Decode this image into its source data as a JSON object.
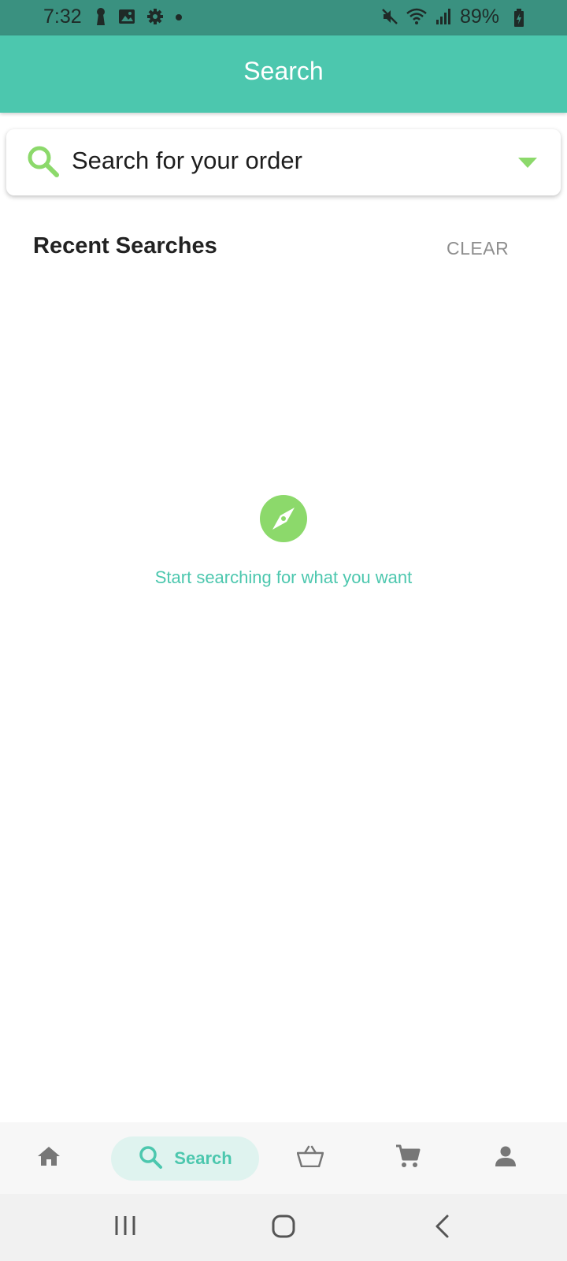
{
  "status_bar": {
    "time": "7:32",
    "battery": "89%",
    "left_icons": [
      "keyhole-icon",
      "image-icon",
      "settings-gear-icon",
      "dot-icon"
    ],
    "right_icons": [
      "mute-icon",
      "wifi-icon",
      "signal-icon",
      "battery-charging-icon"
    ]
  },
  "app_bar": {
    "title": "Search"
  },
  "search": {
    "placeholder": "Search for your order",
    "icon": "search-icon",
    "dropdown_icon": "chevron-down-icon"
  },
  "recent": {
    "title": "Recent Searches",
    "clear_label": "CLEAR"
  },
  "empty_state": {
    "icon": "compass-icon",
    "message": "Start searching for what you want"
  },
  "bottom_nav": {
    "items": [
      {
        "icon": "home-icon",
        "label": "",
        "active": false
      },
      {
        "icon": "search-icon",
        "label": "Search",
        "active": true
      },
      {
        "icon": "basket-icon",
        "label": "",
        "active": false
      },
      {
        "icon": "cart-icon",
        "label": "",
        "active": false
      },
      {
        "icon": "profile-icon",
        "label": "",
        "active": false
      }
    ]
  },
  "system_nav": {
    "buttons": [
      "recent-apps-icon",
      "home-circle-icon",
      "back-icon"
    ]
  },
  "colors": {
    "accent": "#4cc7ae",
    "status_bar": "#3a9180",
    "icon_green": "#8cd96b",
    "nav_active_bg": "#dff3ef"
  }
}
